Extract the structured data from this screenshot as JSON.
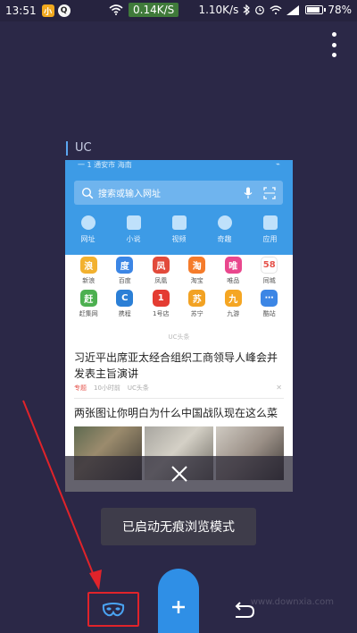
{
  "status_bar": {
    "time": "13:51",
    "app_icon_1": "小",
    "app_icon_2": "Q",
    "speed_badge": "0.14K/S",
    "speed_right": "1.10K/s",
    "battery": "78%",
    "battery_level": 0.78,
    "icons": [
      "wifi-icon",
      "bluetooth-icon",
      "alarm-icon",
      "signal-icon",
      "battery-icon"
    ]
  },
  "tab": {
    "title": "UC"
  },
  "card": {
    "mini_status_left": "一  1    通安市 海南",
    "search_placeholder": "搜索或输入网址",
    "quick_items": [
      {
        "label": "网址"
      },
      {
        "label": "小说"
      },
      {
        "label": "视频"
      },
      {
        "label": "奇趣"
      },
      {
        "label": "应用"
      }
    ],
    "apps": [
      {
        "name": "新浪",
        "glyph": "浪",
        "color": "#f2b12f"
      },
      {
        "name": "百度",
        "glyph": "度",
        "color": "#3c86e5"
      },
      {
        "name": "凤凰",
        "glyph": "凤",
        "color": "#e24a3b"
      },
      {
        "name": "淘宝",
        "glyph": "淘",
        "color": "#f57b2a"
      },
      {
        "name": "唯品",
        "glyph": "唯",
        "color": "#e9478d"
      },
      {
        "name": "同城",
        "glyph": "58",
        "color": "#ffffff"
      },
      {
        "name": "赶集网",
        "glyph": "赶",
        "color": "#4cb050"
      },
      {
        "name": "携程",
        "glyph": "C",
        "color": "#2b7fd6"
      },
      {
        "name": "1号店",
        "glyph": "1",
        "color": "#e43c32"
      },
      {
        "name": "苏宁",
        "glyph": "苏",
        "color": "#f2a223"
      },
      {
        "name": "九游",
        "glyph": "九",
        "color": "#f5a623"
      },
      {
        "name": "酷站",
        "glyph": "⋯",
        "color": "#3c86e5"
      }
    ],
    "uc_divider": "UC头条",
    "news1": "习近平出席亚太经合组织工商领导人峰会并发表主旨演讲",
    "news1_meta": {
      "tag": "专题",
      "time": "10小时前",
      "source": "UC头条"
    },
    "news2": "两张图让你明白为什么中国战队现在这么菜"
  },
  "toast": {
    "text": "已启动无痕浏览模式"
  },
  "watermark": "www.downxia.com",
  "colors": {
    "background": "#2b2847",
    "accent_blue": "#2f8fe6",
    "highlight_red": "#e0232a"
  }
}
